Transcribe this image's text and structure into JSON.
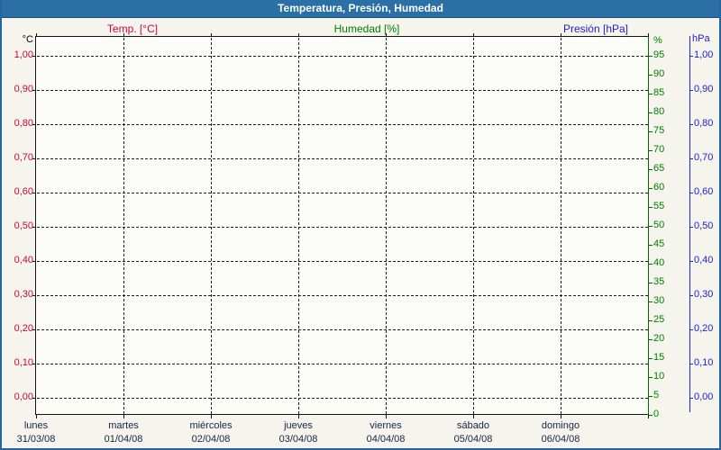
{
  "window": {
    "title": "Temperatura, Presión, Humedad"
  },
  "legend": [
    {
      "id": "temp",
      "label": "Temp. [°C]",
      "color": "#C8083C"
    },
    {
      "id": "humedad",
      "label": "Humedad [%]",
      "color": "#008000"
    },
    {
      "id": "presion",
      "label": "Presión [hPa]",
      "color": "#2121CE"
    }
  ],
  "axes": {
    "temperature": {
      "unit": "°C",
      "color": "#C8083C",
      "ticks": [
        "1,00",
        "0,90",
        "0,80",
        "0,70",
        "0,60",
        "0,50",
        "0,40",
        "0,30",
        "0,20",
        "0,10",
        "0,00"
      ]
    },
    "humidity": {
      "unit": "%",
      "color": "#008000",
      "ticks": [
        "95",
        "90",
        "85",
        "80",
        "75",
        "70",
        "65",
        "60",
        "55",
        "50",
        "45",
        "40",
        "35",
        "30",
        "25",
        "20",
        "15",
        "10",
        "5",
        "0"
      ]
    },
    "pressure": {
      "unit": "hPa",
      "color": "#2121CE",
      "ticks": [
        "1,00",
        "0,90",
        "0,80",
        "0,70",
        "0,60",
        "0,50",
        "0,40",
        "0,30",
        "0,20",
        "0,10",
        "0,00"
      ]
    }
  },
  "x_axis": {
    "days": [
      {
        "name": "lunes",
        "date": "31/03/08"
      },
      {
        "name": "martes",
        "date": "01/04/08"
      },
      {
        "name": "miércoles",
        "date": "02/04/08"
      },
      {
        "name": "jueves",
        "date": "03/04/08"
      },
      {
        "name": "viernes",
        "date": "04/04/08"
      },
      {
        "name": "sábado",
        "date": "05/04/08"
      },
      {
        "name": "domingo",
        "date": "06/04/08"
      }
    ]
  },
  "colors": {
    "titlebar": "#2A70A5",
    "window_border": "#2264A4",
    "background": "#F5F4ED",
    "plot_background": "#FCFCF8",
    "grid": "#1C1C1C",
    "temperature": "#C8083C",
    "humidity": "#008000",
    "humidity_axis_line": "#006B00",
    "pressure": "#2121CE",
    "day_text": "#182342"
  },
  "chart_data": {
    "type": "line",
    "title": "Temperatura, Presión, Humedad",
    "x_day_names": [
      "lunes",
      "martes",
      "miércoles",
      "jueves",
      "viernes",
      "sábado",
      "domingo"
    ],
    "x_categories": [
      "31/03/08",
      "01/04/08",
      "02/04/08",
      "03/04/08",
      "04/04/08",
      "05/04/08",
      "06/04/08"
    ],
    "series": [
      {
        "name": "Temp. [°C]",
        "axis": "left",
        "color": "#C8083C",
        "values": []
      },
      {
        "name": "Humedad [%]",
        "axis": "right-inner",
        "color": "#008000",
        "values": []
      },
      {
        "name": "Presión [hPa]",
        "axis": "right-outer",
        "color": "#2121CE",
        "values": []
      }
    ],
    "left_axis": {
      "label": "°C",
      "min": 0.0,
      "max": 1.0,
      "step": 0.1
    },
    "right_inner_axis": {
      "label": "%",
      "min": 0,
      "max": 100,
      "step": 5
    },
    "right_outer_axis": {
      "label": "hPa",
      "min": 0.0,
      "max": 1.0,
      "step": 0.1
    },
    "grid": true,
    "legend_position": "top",
    "plot_empty": true
  }
}
